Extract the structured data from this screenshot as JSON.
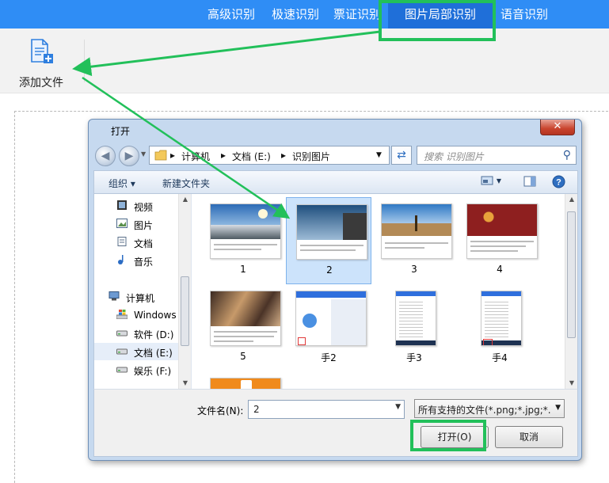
{
  "top_tabs": [
    {
      "label": "高级识别"
    },
    {
      "label": "极速识别"
    },
    {
      "label": "票证识别"
    },
    {
      "label": "图片局部识别",
      "active": true
    },
    {
      "label": "语音识别"
    }
  ],
  "toolbar": {
    "add_file_label": "添加文件"
  },
  "dialog": {
    "title": "打开",
    "close_label": "✕",
    "address": {
      "computer": "计算机",
      "drive": "文档 (E:)",
      "folder": "识别图片"
    },
    "search_placeholder": "搜索 识别图片",
    "commands": {
      "organize": "组织 ▾",
      "new_folder": "新建文件夹"
    },
    "nav": [
      {
        "label": "视频",
        "icon": "video-icon"
      },
      {
        "label": "图片",
        "icon": "picture-icon"
      },
      {
        "label": "文档",
        "icon": "document-icon"
      },
      {
        "label": "音乐",
        "icon": "music-icon"
      },
      {
        "label": "计算机",
        "icon": "computer-icon"
      },
      {
        "label": "Windows",
        "icon": "windows-drive-icon"
      },
      {
        "label": "软件 (D:)",
        "icon": "drive-icon"
      },
      {
        "label": "文档 (E:)",
        "icon": "drive-icon",
        "selected": true
      },
      {
        "label": "娱乐 (F:)",
        "icon": "drive-icon"
      }
    ],
    "files": [
      {
        "name": "1",
        "kind": "landscape"
      },
      {
        "name": "2",
        "kind": "sky",
        "selected": true
      },
      {
        "name": "3",
        "kind": "tree"
      },
      {
        "name": "4",
        "kind": "red"
      },
      {
        "name": "5",
        "kind": "crowd"
      },
      {
        "name": "手2",
        "kind": "phone"
      },
      {
        "name": "手3",
        "kind": "phone-list"
      },
      {
        "name": "手4",
        "kind": "phone-list"
      },
      {
        "name": "",
        "kind": "orange"
      }
    ],
    "filename_label": "文件名(N):",
    "filename_value": "2",
    "filetype_value": "所有支持的文件(*.png;*.jpg;*.bmp)",
    "open_button": "打开(O)",
    "cancel_button": "取消"
  },
  "colors": {
    "accent": "#2f8df5",
    "active_tab": "#1f6fd9",
    "annotation": "#22c05a"
  }
}
